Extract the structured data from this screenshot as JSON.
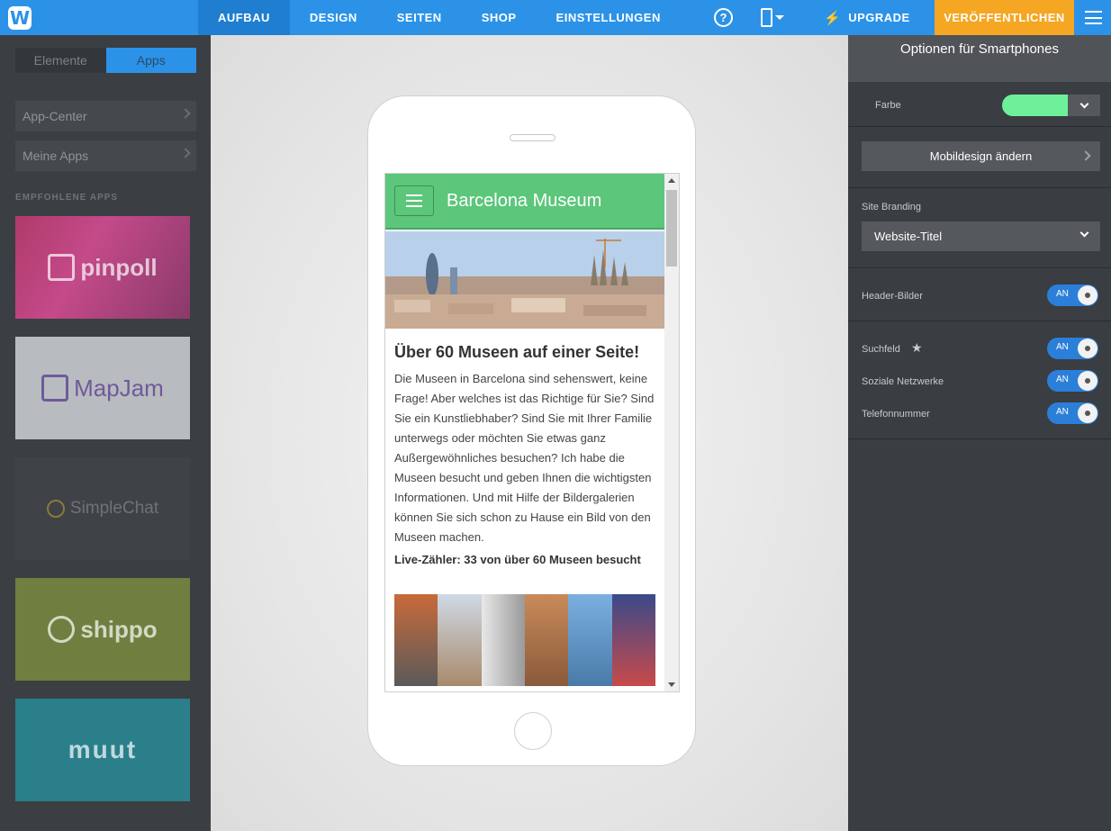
{
  "topbar": {
    "logo": "W",
    "nav": [
      "AUFBAU",
      "DESIGN",
      "SEITEN",
      "SHOP",
      "EINSTELLUNGEN"
    ],
    "help": "?",
    "upgrade": "UPGRADE",
    "publish": "VERÖFFENTLICHEN"
  },
  "left": {
    "tabs": [
      "Elemente",
      "Apps"
    ],
    "rows": [
      "App-Center",
      "Meine Apps"
    ],
    "recommended_title": "EMPFOHLENE APPS",
    "apps": [
      "pinpoll",
      "MapJam",
      "SimpleChat",
      "shippo",
      "muut"
    ]
  },
  "preview": {
    "site_title": "Barcelona Museum",
    "heading": "Über 60 Museen auf einer Seite!",
    "text": "Die Museen in Barcelona sind sehenswert, keine Frage! Aber welches ist das Richtige für Sie? Sind Sie ein Kunstliebhaber? Sind Sie mit Ihrer Familie unterwegs oder möchten Sie etwas ganz Außergewöhnliches besuchen? Ich habe die Museen besucht und geben Ihnen die wichtigsten Informationen. Und mit Hilfe der Bildergalerien können Sie sich schon zu Hause ein Bild von den Museen machen.",
    "counter": "Live-Zähler: 33 von über 60 Museen besucht"
  },
  "right": {
    "title": "Optionen für Smartphones",
    "color_label": "Farbe",
    "color_value": "#6ef09a",
    "mobile_design_button": "Mobildesign ändern",
    "branding_label": "Site Branding",
    "branding_value": "Website-Titel",
    "header_images_label": "Header-Bilder",
    "search_label": "Suchfeld",
    "social_label": "Soziale Netzwerke",
    "phone_label": "Telefonnummer",
    "toggle_on": "AN"
  }
}
